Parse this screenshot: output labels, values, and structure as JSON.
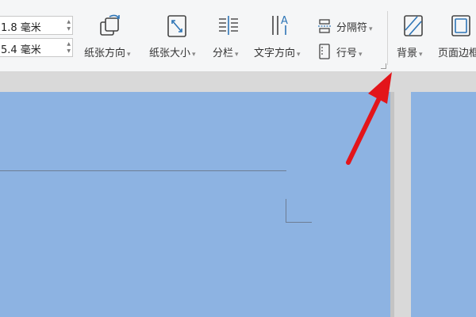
{
  "ribbon": {
    "margin_top_value": "1.8 毫米",
    "margin_bottom_value": "5.4 毫米",
    "orientation_label": "纸张方向",
    "size_label": "纸张大小",
    "columns_label": "分栏",
    "text_direction_label": "文字方向",
    "separator_label": "分隔符",
    "line_number_label": "行号",
    "background_label": "背景",
    "page_border_label": "页面边框",
    "dropdown_caret": "▾"
  },
  "icons": {
    "orientation": "page-rotate-icon",
    "size": "page-resize-icon",
    "columns": "columns-icon",
    "text_direction": "text-direction-icon",
    "separator": "separator-icon",
    "line_number": "line-number-icon",
    "background": "page-background-icon",
    "page_border": "page-border-icon"
  },
  "colors": {
    "page_fill": "#8db3e2",
    "ribbon_bg": "#f5f6f7",
    "icon_blue": "#2e75b6",
    "arrow_red": "#e3151a"
  }
}
